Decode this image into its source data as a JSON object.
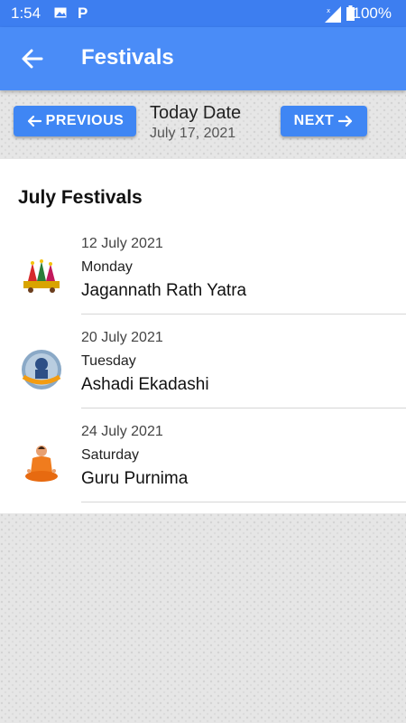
{
  "status": {
    "time": "1:54",
    "battery": "100%",
    "p_icon": "P"
  },
  "app_bar": {
    "title": "Festivals",
    "back_icon": "arrow-left-icon"
  },
  "nav": {
    "prev_label": "PREVIOUS",
    "next_label": "NEXT",
    "today_label": "Today Date",
    "today_date": "July 17, 2021"
  },
  "section": {
    "title": "July Festivals"
  },
  "festivals": [
    {
      "date": "12 July 2021",
      "day": "Monday",
      "name": "Jagannath Rath Yatra",
      "icon": "rath-yatra-icon"
    },
    {
      "date": "20 July 2021",
      "day": "Tuesday",
      "name": "Ashadi Ekadashi",
      "icon": "vitthal-icon"
    },
    {
      "date": "24 July 2021",
      "day": "Saturday",
      "name": "Guru Purnima",
      "icon": "guru-icon"
    }
  ],
  "colors": {
    "status_bar": "#3d7ef0",
    "app_bar": "#4a8cf7",
    "button": "#3f86f4"
  }
}
